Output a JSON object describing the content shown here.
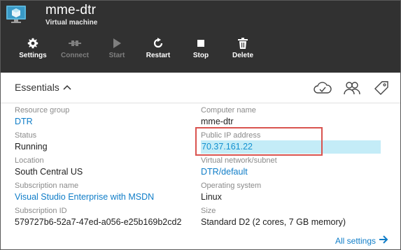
{
  "header": {
    "title": "mme-dtr",
    "subtitle": "Virtual machine",
    "icon": "virtual-machine-icon"
  },
  "toolbar": {
    "buttons": [
      {
        "label": "Settings",
        "icon": "gear-icon",
        "enabled": true
      },
      {
        "label": "Connect",
        "icon": "plug-icon",
        "enabled": false
      },
      {
        "label": "Start",
        "icon": "play-icon",
        "enabled": false
      },
      {
        "label": "Restart",
        "icon": "restart-icon",
        "enabled": true
      },
      {
        "label": "Stop",
        "icon": "stop-icon",
        "enabled": true
      },
      {
        "label": "Delete",
        "icon": "trash-icon",
        "enabled": true
      }
    ]
  },
  "essentials": {
    "title": "Essentials",
    "icons": [
      "cloud-icon",
      "users-icon",
      "tag-icon"
    ]
  },
  "properties": {
    "left": [
      {
        "label": "Resource group",
        "value": "DTR",
        "link": true
      },
      {
        "label": "Status",
        "value": "Running",
        "link": false
      },
      {
        "label": "Location",
        "value": "South Central US",
        "link": false
      },
      {
        "label": "Subscription name",
        "value": "Visual Studio Enterprise with MSDN",
        "link": true
      },
      {
        "label": "Subscription ID",
        "value": "579727b6-52a7-47ed-a056-e25b169b2cd2",
        "link": false
      }
    ],
    "right": [
      {
        "label": "Computer name",
        "value": "mme-dtr",
        "link": false
      },
      {
        "label": "Public IP address",
        "value": "70.37.161.22",
        "link": true,
        "highlighted": true
      },
      {
        "label": "Virtual network/subnet",
        "value": "DTR/default",
        "link": true
      },
      {
        "label": "Operating system",
        "value": "Linux",
        "link": false
      },
      {
        "label": "Size",
        "value": "Standard D2 (2 cores, 7 GB memory)",
        "link": false
      }
    ]
  },
  "footer": {
    "all_settings": "All settings"
  },
  "colors": {
    "header_bg": "#313131",
    "link": "#0f7dc8",
    "highlight_bg": "#c4ecf7",
    "annotation_border": "#d9534f"
  }
}
